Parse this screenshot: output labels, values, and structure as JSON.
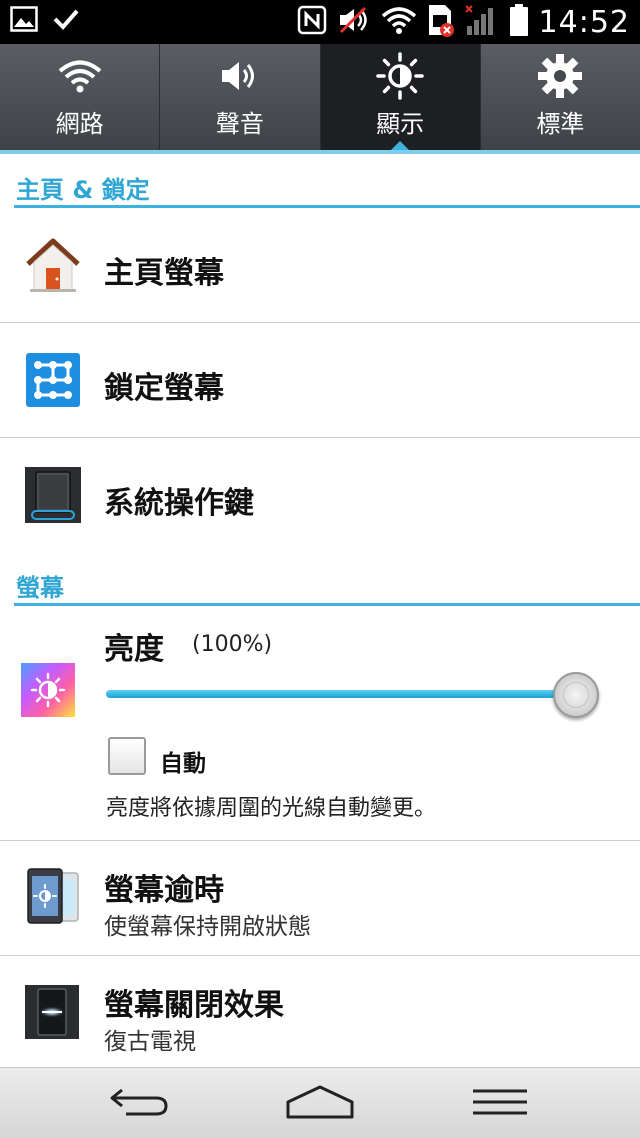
{
  "status_bar": {
    "time": "14:52",
    "left_icons": [
      "image-icon",
      "checkmark-icon"
    ],
    "right_icons": [
      "nfc-icon",
      "muted-speaker-icon",
      "wifi-icon",
      "sim-error-icon",
      "signal-icon",
      "battery-icon"
    ]
  },
  "tabs": [
    {
      "label": "網路",
      "icon": "wifi-icon",
      "active": false
    },
    {
      "label": "聲音",
      "icon": "speaker-icon",
      "active": false
    },
    {
      "label": "顯示",
      "icon": "brightness-icon",
      "active": true
    },
    {
      "label": "標準",
      "icon": "gear-icon",
      "active": false
    }
  ],
  "sections": {
    "home_lock": {
      "header": "主頁 & 鎖定",
      "items": [
        {
          "title": "主頁螢幕",
          "icon": "home-icon"
        },
        {
          "title": "鎖定螢幕",
          "icon": "lock-pattern-icon"
        },
        {
          "title": "系統操作鍵",
          "icon": "phone-keys-icon"
        }
      ]
    },
    "screen": {
      "header": "螢幕",
      "brightness": {
        "title": "亮度",
        "value_text": "(100%)",
        "level": 1.0,
        "auto_label": "自動",
        "auto_checked": false,
        "description": "亮度將依據周圍的光線自動變更。",
        "icon": "brightness-color-icon"
      },
      "timeout": {
        "title": "螢幕逾時",
        "subtitle": "使螢幕保持開啟狀態",
        "icon": "screen-timeout-icon"
      },
      "off_effect": {
        "title": "螢幕關閉效果",
        "subtitle": "復古電視",
        "icon": "screen-off-effect-icon"
      }
    }
  },
  "navbar": {
    "buttons": [
      "back-icon",
      "home-nav-icon",
      "menu-icon"
    ]
  },
  "colors": {
    "accent": "#3db2e0",
    "tab_bg": "#4a4d52",
    "tab_active_bg": "#1d1f22"
  }
}
